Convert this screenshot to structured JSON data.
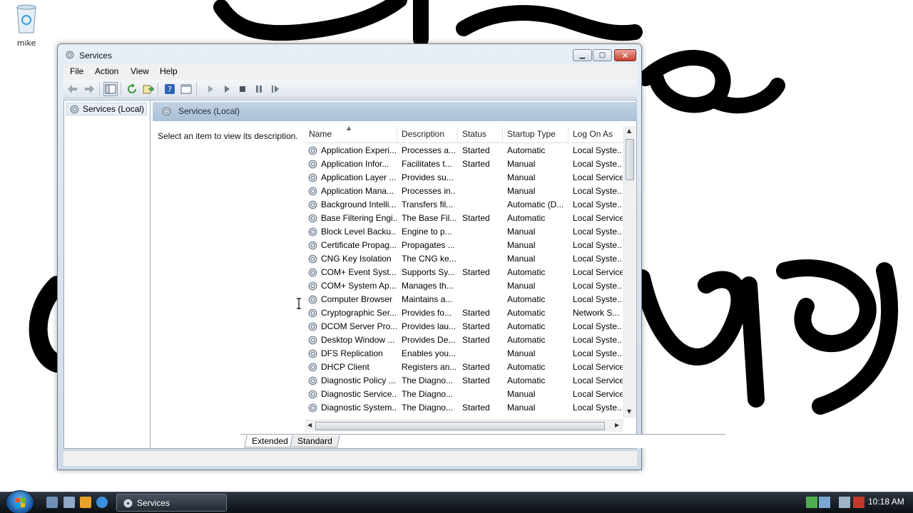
{
  "desktop": {
    "icons": [
      {
        "label": "mike",
        "icon": "recycle-bin-icon"
      }
    ]
  },
  "window": {
    "title": "Services",
    "menu": [
      "File",
      "Action",
      "View",
      "Help"
    ]
  },
  "tree": {
    "root_label": "Services (Local)"
  },
  "panel": {
    "header": "Services (Local)",
    "description": "Select an item to view its description."
  },
  "table": {
    "columns": [
      "Name",
      "Description",
      "Status",
      "Startup Type",
      "Log On As"
    ],
    "sorted_column": "Name",
    "rows": [
      [
        "Application Experi...",
        "Processes a...",
        "Started",
        "Automatic",
        "Local Syste..."
      ],
      [
        "Application Infor...",
        "Facilitates t...",
        "Started",
        "Manual",
        "Local Syste..."
      ],
      [
        "Application Layer ...",
        "Provides su...",
        "",
        "Manual",
        "Local Service"
      ],
      [
        "Application Mana...",
        "Processes in...",
        "",
        "Manual",
        "Local Syste..."
      ],
      [
        "Background Intelli...",
        "Transfers fil...",
        "",
        "Automatic (D...",
        "Local Syste..."
      ],
      [
        "Base Filtering Engi...",
        "The Base Fil...",
        "Started",
        "Automatic",
        "Local Service"
      ],
      [
        "Block Level Backu...",
        "Engine to p...",
        "",
        "Manual",
        "Local Syste..."
      ],
      [
        "Certificate Propag...",
        "Propagates ...",
        "",
        "Manual",
        "Local Syste..."
      ],
      [
        "CNG Key Isolation",
        "The CNG ke...",
        "",
        "Manual",
        "Local Syste..."
      ],
      [
        "COM+ Event Syst...",
        "Supports Sy...",
        "Started",
        "Automatic",
        "Local Service"
      ],
      [
        "COM+ System Ap...",
        "Manages th...",
        "",
        "Manual",
        "Local Syste..."
      ],
      [
        "Computer Browser",
        "Maintains a...",
        "",
        "Automatic",
        "Local Syste..."
      ],
      [
        "Cryptographic Ser...",
        "Provides fo...",
        "Started",
        "Automatic",
        "Network S..."
      ],
      [
        "DCOM Server Pro...",
        "Provides lau...",
        "Started",
        "Automatic",
        "Local Syste..."
      ],
      [
        "Desktop Window ...",
        "Provides De...",
        "Started",
        "Automatic",
        "Local Syste..."
      ],
      [
        "DFS Replication",
        "Enables you...",
        "",
        "Manual",
        "Local Syste..."
      ],
      [
        "DHCP Client",
        "Registers an...",
        "Started",
        "Automatic",
        "Local Service"
      ],
      [
        "Diagnostic Policy ...",
        "The Diagno...",
        "Started",
        "Automatic",
        "Local Service"
      ],
      [
        "Diagnostic Service...",
        "The Diagno...",
        "",
        "Manual",
        "Local Service"
      ],
      [
        "Diagnostic System...",
        "The Diagno...",
        "Started",
        "Manual",
        "Local Syste..."
      ]
    ]
  },
  "tabs": [
    "Extended",
    "Standard"
  ],
  "taskbar": {
    "task_label": "Services",
    "clock": "10:18 AM"
  },
  "colors": {
    "header_band": "#b3c7dc",
    "close_button": "#c8412f"
  }
}
